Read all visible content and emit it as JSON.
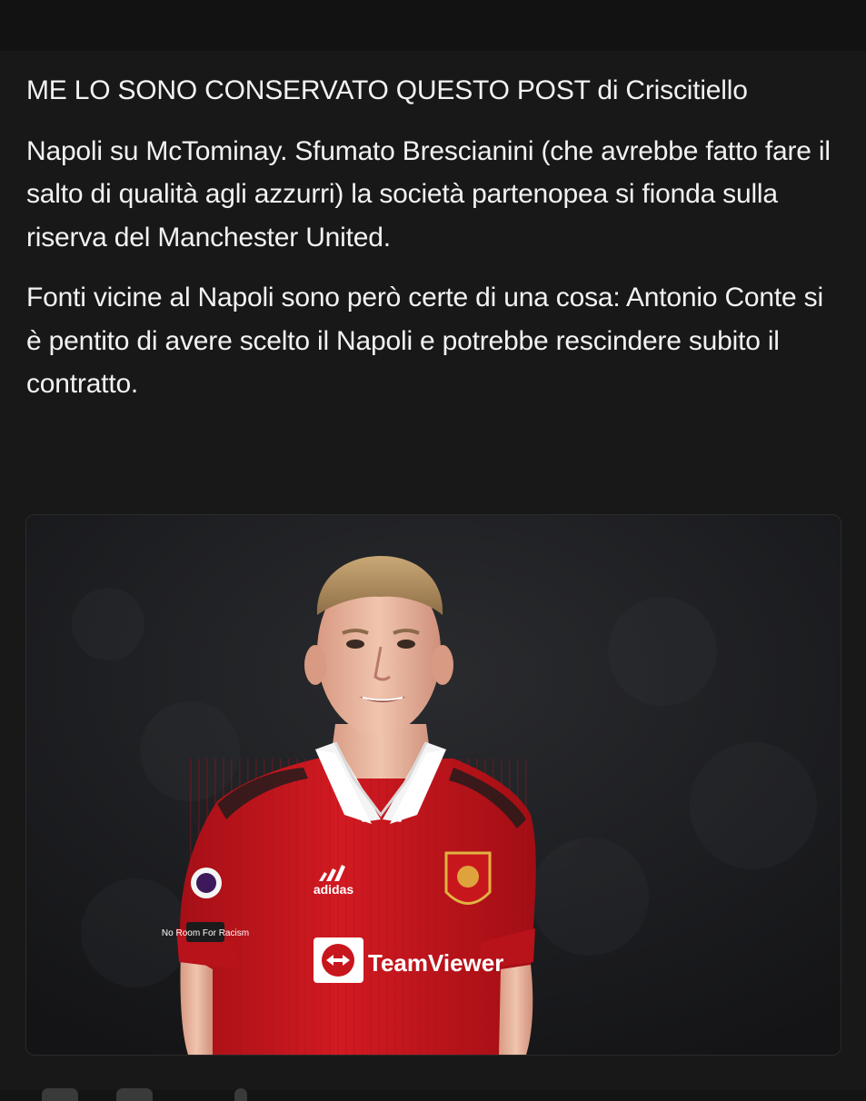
{
  "post": {
    "paragraphs": [
      "ME LO SONO CONSERVATO QUESTO POST di Criscitiello",
      "Napoli su McTominay. Sfumato Brescianini (che avrebbe fatto fare il salto di qualità agli azzurri) la società partenopea si fionda sulla riserva del Manchester United.",
      "Fonti vicine al Napoli sono però certe di una cosa: Antonio Conte si è pentito di avere scelto il Napoli e potrebbe rescindere subito il contratto."
    ],
    "image": {
      "shirt_brand": "adidas",
      "sponsor": "TeamViewer",
      "sleeve_patch": "No Room For Racism"
    }
  },
  "colors": {
    "background": "#181818",
    "text": "#f2f2f2",
    "shirt_red": "#c8161d"
  }
}
